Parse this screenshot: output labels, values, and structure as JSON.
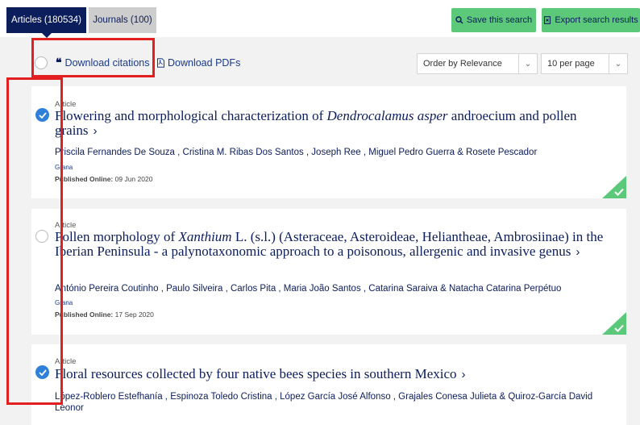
{
  "tabs": {
    "articles": "Articles (180534)",
    "journals": "Journals (100)"
  },
  "actions": {
    "save_search": "Save this search",
    "export_results": "Export search results"
  },
  "toolbar": {
    "download_citations": "Download citations",
    "download_pdfs": "Download PDFs",
    "order_by": "Order by Relevance",
    "per_page": "10 per page"
  },
  "results": [
    {
      "type": "Article",
      "title_pre": "Flowering and morphological characterization of ",
      "title_em": "Dendrocalamus asper",
      "title_post": " androecium and pollen grains",
      "authors": "Priscila Fernandes De Souza , Cristina M. Ribas Dos Santos , Joseph Ree , Miguel Pedro Guerra & Rosete Pescador",
      "journal": "Grana",
      "published_label": "Published Online:",
      "published_date": "09 Jun 2020",
      "selected": true
    },
    {
      "type": "Article",
      "title_pre": "Pollen morphology of ",
      "title_em": "Xanthium",
      "title_post": " L. (s.l.) (Asteraceae, Asteroideae, Heliantheae, Ambrosiinae) in the Iberian Peninsula - a palynotaxonomic approach to a poisonous, allergenic and invasive genus",
      "authors": "António Pereira Coutinho , Paulo Silveira , Carlos Pita , Maria João Santos , Catarina Saraiva & Natacha Catarina Perpétuo",
      "journal": "Grana",
      "published_label": "Published Online:",
      "published_date": "17 Sep 2020",
      "selected": false
    },
    {
      "type": "Article",
      "title_pre": "Floral resources collected by four native bees species in southern Mexico",
      "authors": "López-Roblero Estefhanía , Espinoza Toledo Cristina , López García José Alfonso , Grajales Conesa Julieta & Quiroz-García David Leonor",
      "selected": true
    }
  ],
  "colors": {
    "navy": "#0c1d5b",
    "green": "#5cc97a",
    "check_blue": "#2f80d8",
    "annotation_red": "#e32020"
  }
}
